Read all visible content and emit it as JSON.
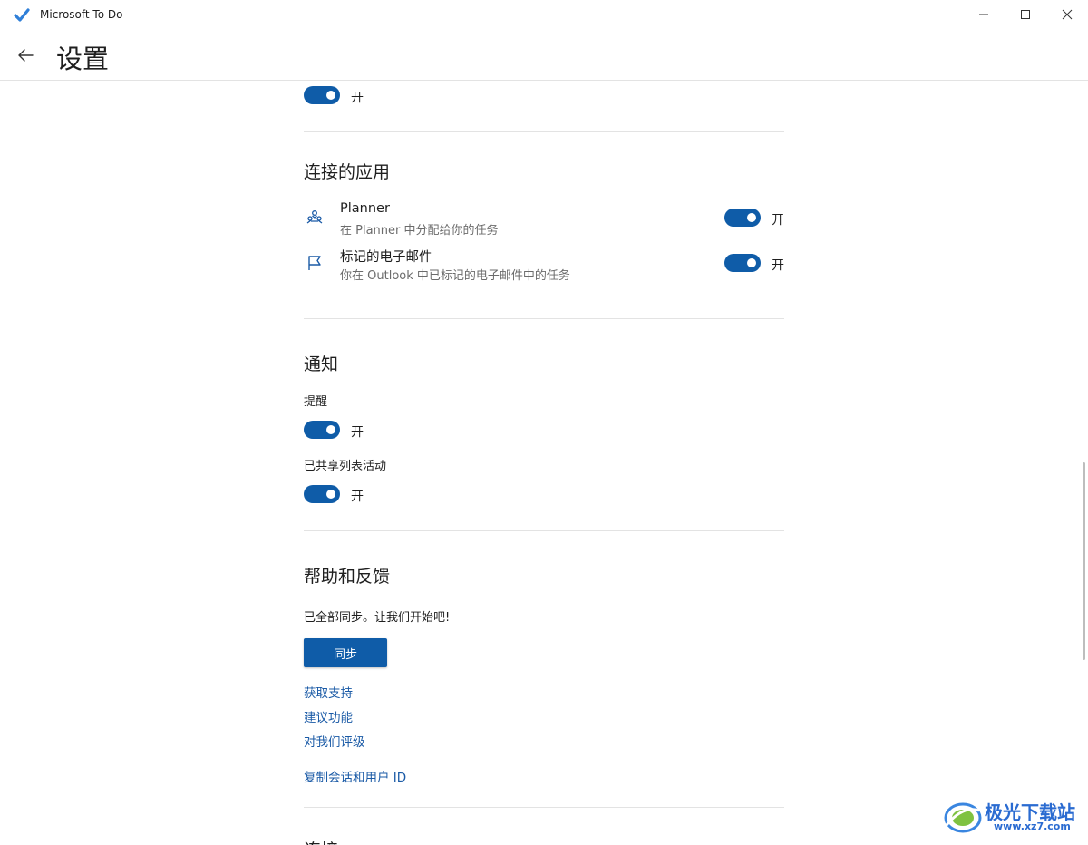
{
  "window": {
    "title": "Microsoft To Do",
    "minimize_icon": "minimize-icon",
    "maximize_icon": "maximize-icon",
    "close_icon": "close-icon"
  },
  "header": {
    "back_icon": "back-arrow-icon",
    "title": "设置"
  },
  "top_toggle": {
    "state": "开",
    "on": true
  },
  "connected_apps": {
    "title": "连接的应用",
    "items": [
      {
        "icon": "planner-icon",
        "title": "Planner",
        "description": "在 Planner 中分配给你的任务",
        "state": "开",
        "on": true
      },
      {
        "icon": "flag-icon",
        "title": "标记的电子邮件",
        "description": "你在 Outlook 中已标记的电子邮件中的任务",
        "state": "开",
        "on": true
      }
    ]
  },
  "notifications": {
    "title": "通知",
    "reminders": {
      "label": "提醒",
      "state": "开",
      "on": true
    },
    "shared_list_activity": {
      "label": "已共享列表活动",
      "state": "开",
      "on": true
    }
  },
  "help": {
    "title": "帮助和反馈",
    "sync_status": "已全部同步。让我们开始吧!",
    "sync_button": "同步",
    "links": [
      "获取支持",
      "建议功能",
      "对我们评级"
    ],
    "copy_id_link": "复制会话和用户 ID"
  },
  "next_section": {
    "title": "连接"
  },
  "watermark": {
    "title": "极光下载站",
    "url": "www.xz7.com"
  },
  "colors": {
    "accent": "#0f5ca8",
    "link": "#1a5aa6",
    "divider": "#e3e3e3"
  }
}
